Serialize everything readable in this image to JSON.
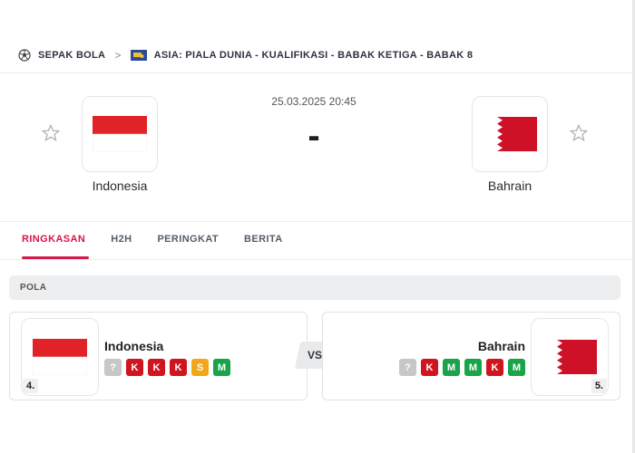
{
  "breadcrumb": {
    "sport": "SEPAK BOLA",
    "separator": ">",
    "competition": "ASIA: PIALA DUNIA - KUALIFIKASI - BABAK KETIGA - BABAK 8",
    "sport_icon": "soccer-ball-icon",
    "region_icon": "asia-flag-icon"
  },
  "match": {
    "datetime": "25.03.2025 20:45",
    "score": "-",
    "home": {
      "name": "Indonesia",
      "flag": "indonesia-flag"
    },
    "away": {
      "name": "Bahrain",
      "flag": "bahrain-flag"
    }
  },
  "tabs": [
    {
      "label": "RINGKASAN",
      "active": true
    },
    {
      "label": "H2H",
      "active": false
    },
    {
      "label": "PERINGKAT",
      "active": false
    },
    {
      "label": "BERITA",
      "active": false
    }
  ],
  "form": {
    "title": "POLA",
    "vs_label": "VS",
    "home": {
      "name": "Indonesia",
      "rank": "4.",
      "results": [
        "?",
        "K",
        "K",
        "K",
        "S",
        "M"
      ]
    },
    "away": {
      "name": "Bahrain",
      "rank": "5.",
      "results": [
        "?",
        "K",
        "M",
        "M",
        "K",
        "M"
      ]
    }
  },
  "colors": {
    "accent": "#d6174a",
    "loss": "#d0151f",
    "win": "#19a34a",
    "draw": "#f2a71b",
    "unknown": "#c7c7c7"
  }
}
